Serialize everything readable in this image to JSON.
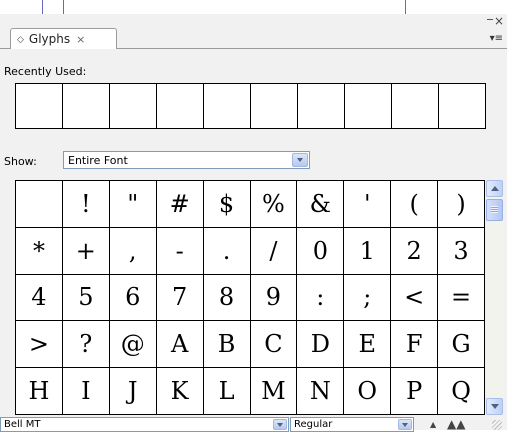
{
  "panel": {
    "tab_title": "Glyphs",
    "tab_icon": "diamond-icon",
    "tab_close_glyph": "×"
  },
  "recent": {
    "label": "Recently Used:",
    "slots": 10
  },
  "show": {
    "label": "Show:",
    "value": "Entire Font"
  },
  "glyphs": [
    "",
    "!",
    "\"",
    "#",
    "$",
    "%",
    "&",
    "'",
    "(",
    ")",
    "*",
    "+",
    ",",
    "-",
    ".",
    "/",
    "0",
    "1",
    "2",
    "3",
    "4",
    "5",
    "6",
    "7",
    "8",
    "9",
    ":",
    ";",
    "<",
    "=",
    ">",
    "?",
    "@",
    "A",
    "B",
    "C",
    "D",
    "E",
    "F",
    "G",
    "H",
    "I",
    "J",
    "K",
    "L",
    "M",
    "N",
    "O",
    "P",
    "Q"
  ],
  "font": {
    "family": "Bell MT",
    "style": "Regular"
  },
  "colors": {
    "panel_bg": "#f1f1f1",
    "grid_line": "#000000",
    "scroll_accent": "#bfd0f5"
  }
}
